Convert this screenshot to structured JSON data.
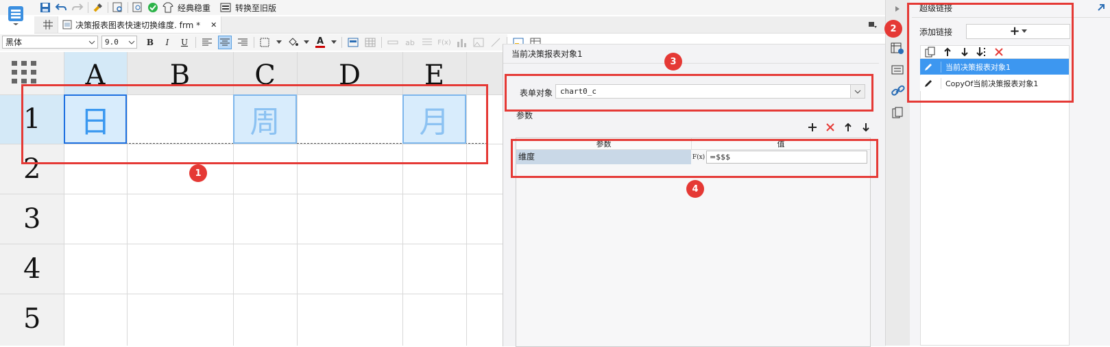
{
  "toolbar": {
    "stable_label": "经典稳重",
    "switch_label": "转换至旧版",
    "font_name": "黑体",
    "font_size": "9.0",
    "bold": "B",
    "italic": "I",
    "underline": "U",
    "text_color_letter": "A"
  },
  "tab": {
    "title": "决策报表图表快速切换维度. frm *",
    "close": "✕"
  },
  "sheet": {
    "columns": [
      "A",
      "B",
      "C",
      "D",
      "E"
    ],
    "rows": [
      "1",
      "2",
      "3",
      "4",
      "5"
    ],
    "cells": {
      "A1": "日",
      "C1": "周",
      "E1": "月"
    }
  },
  "dialog": {
    "title": "当前决策报表对象1",
    "form_object_label": "表单对象",
    "form_object_value": "chart0_c",
    "params_label": "参数",
    "col_param": "参数",
    "col_value": "值",
    "param_name": "维度",
    "param_value": "=$$$",
    "fx": "F(x)"
  },
  "hyperlink_panel": {
    "title": "超级链接",
    "add_link_label": "添加链接",
    "add_button": "+",
    "items": [
      {
        "label": "当前决策报表对象1",
        "selected": true
      },
      {
        "label": "CopyOf当前决策报表对象1",
        "selected": false
      }
    ]
  },
  "badges": [
    "1",
    "2",
    "3",
    "4"
  ],
  "colors": {
    "accent": "#3399ff",
    "red": "#e53935",
    "selected_row": "#3d97f0",
    "cell_highlight": "#cfe7fb",
    "header_bg": "#e9e9e9"
  }
}
